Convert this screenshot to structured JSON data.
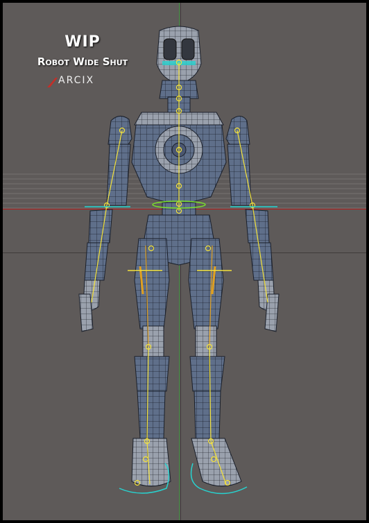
{
  "overlay": {
    "title": "WIP",
    "subtitle": "Robot Wide Shut",
    "logo_text": "ARCIX"
  },
  "colors": {
    "background": "#5e5a59",
    "frame": "#000000",
    "mesh_fill": "#5f6f8a",
    "mesh_line": "#1a1f2a",
    "joint_yellow": "#f4e23a",
    "bone_orange": "#e0a020",
    "control_cyan": "#27d3d0",
    "axis_red": "#b51a1a",
    "axis_green": "#3a9a3a"
  }
}
